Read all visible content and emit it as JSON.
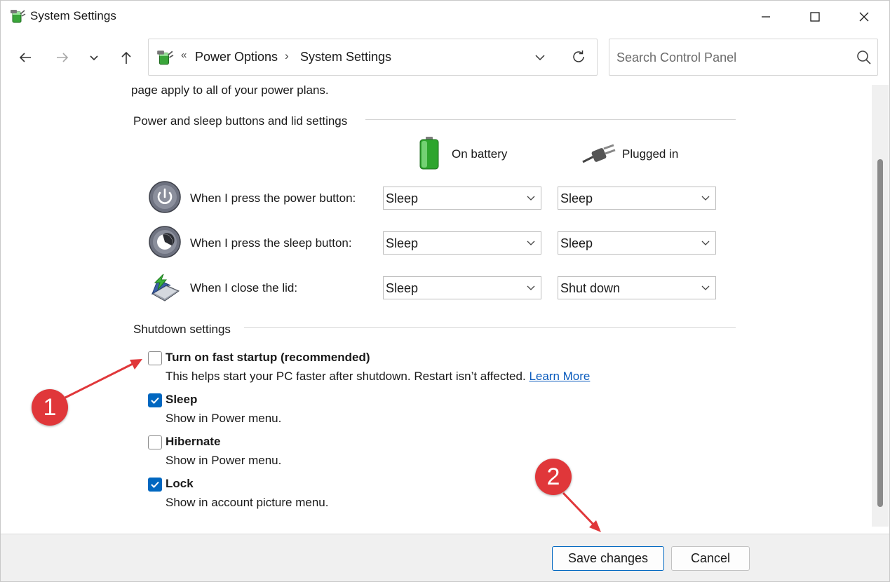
{
  "window": {
    "title": "System Settings",
    "icon": "power-options-icon",
    "controls": [
      "minimize-icon",
      "maximize-icon",
      "close-icon"
    ]
  },
  "nav": {
    "breadcrumb_prefix": "«",
    "breadcrumbs": [
      "Power Options",
      "System Settings"
    ],
    "separator": "›",
    "search_placeholder": "Search Control Panel"
  },
  "content": {
    "intro_text": "page apply to all of your power plans.",
    "power_group_label": "Power and sleep buttons and lid settings",
    "columns": {
      "on_battery": "On battery",
      "plugged_in": "Plugged in"
    },
    "rows": [
      {
        "label": "When I press the power button:",
        "on_battery": "Sleep",
        "plugged_in": "Sleep",
        "icon": "power-button-icon"
      },
      {
        "label": "When I press the sleep button:",
        "on_battery": "Sleep",
        "plugged_in": "Sleep",
        "icon": "sleep-button-icon"
      },
      {
        "label": "When I close the lid:",
        "on_battery": "Sleep",
        "plugged_in": "Shut down",
        "icon": "laptop-lid-icon"
      }
    ],
    "shutdown_group_label": "Shutdown settings",
    "options": [
      {
        "title": "Turn on fast startup (recommended)",
        "desc": "This helps start your PC faster after shutdown. Restart isn’t affected.",
        "link": "Learn More",
        "checked": false
      },
      {
        "title": "Sleep",
        "desc": "Show in Power menu.",
        "checked": true
      },
      {
        "title": "Hibernate",
        "desc": "Show in Power menu.",
        "checked": false
      },
      {
        "title": "Lock",
        "desc": "Show in account picture menu.",
        "checked": true
      }
    ]
  },
  "footer": {
    "save_label": "Save changes",
    "cancel_label": "Cancel"
  },
  "annotations": {
    "badge1": "1",
    "badge2": "2",
    "color": "#e0373a"
  },
  "colors": {
    "accent": "#0067c0",
    "link": "#0a5bbd"
  }
}
